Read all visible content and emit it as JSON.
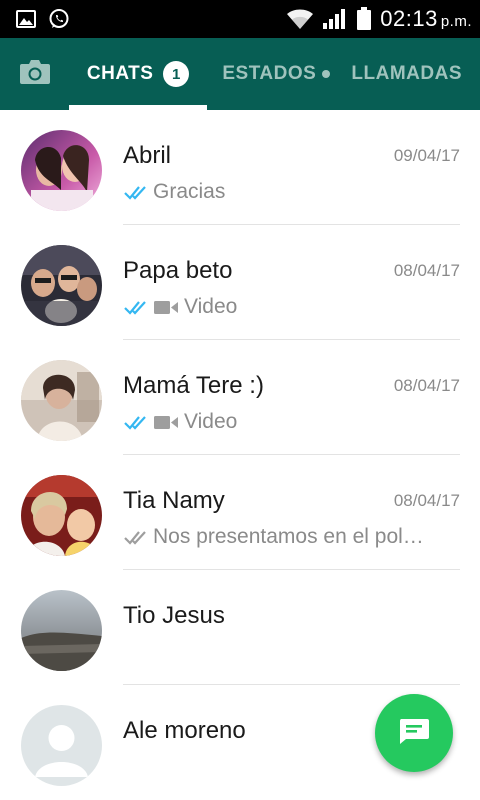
{
  "status_bar": {
    "time": "02:13",
    "time_suffix": "p.m.",
    "icons": [
      "image-icon",
      "whatsapp-icon",
      "wifi-icon",
      "signal-icon",
      "battery-icon"
    ]
  },
  "tabs": {
    "camera_icon": "camera-icon",
    "chats": {
      "label": "CHATS",
      "badge": "1"
    },
    "status": {
      "label": "ESTADOS"
    },
    "calls": {
      "label": "LLAMADAS"
    }
  },
  "chats": [
    {
      "name": "Abril",
      "date": "09/04/17",
      "preview": "Gracias",
      "ticks": "read",
      "media": ""
    },
    {
      "name": "Papa beto",
      "date": "08/04/17",
      "preview": "Video",
      "ticks": "read",
      "media": "video"
    },
    {
      "name": "Mamá Tere :)",
      "date": "08/04/17",
      "preview": "Video",
      "ticks": "read",
      "media": "video"
    },
    {
      "name": "Tia Namy",
      "date": "08/04/17",
      "preview": "Nos presentamos en el pol…",
      "ticks": "delivered",
      "media": ""
    },
    {
      "name": "Tio Jesus",
      "date": "",
      "preview": "",
      "ticks": "",
      "media": ""
    },
    {
      "name": "Ale moreno",
      "date": "",
      "preview": "",
      "ticks": "",
      "media": ""
    }
  ],
  "fab": {
    "icon": "new-chat-icon"
  },
  "colors": {
    "header": "#075e54",
    "accent": "#25c95f",
    "read_ticks": "#34b7f1",
    "delivered_ticks": "#9e9e9e"
  }
}
